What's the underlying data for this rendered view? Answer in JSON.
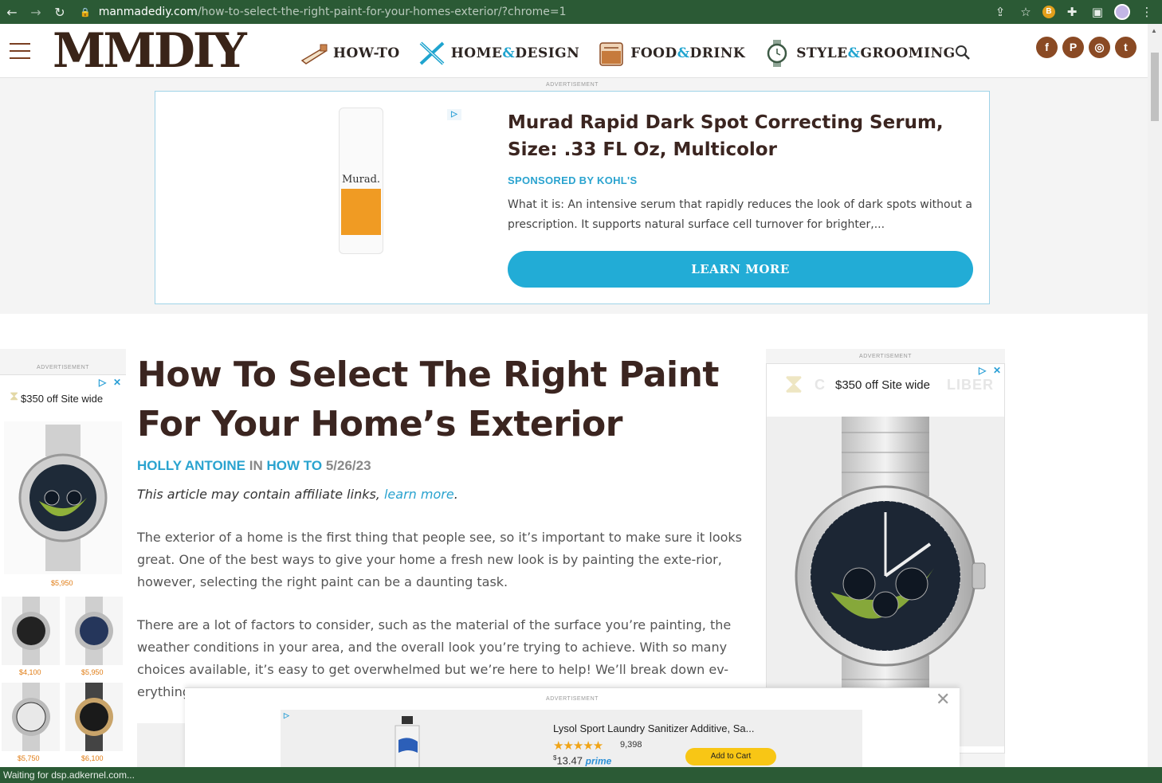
{
  "browser": {
    "url_host": "manmadediy.com",
    "url_path": "/how-to-select-the-right-paint-for-your-homes-exterior/?chrome=1",
    "status_text": "Waiting for dsp.adkernel.com..."
  },
  "site": {
    "logo": "MMDIY",
    "nav": [
      {
        "pre": "HOW-TO",
        "amp": "",
        "post": ""
      },
      {
        "pre": "HOME",
        "amp": "&",
        "post": "DESIGN"
      },
      {
        "pre": "FOOD",
        "amp": "&",
        "post": "DRINK"
      },
      {
        "pre": "STYLE",
        "amp": "&",
        "post": "GROOMING"
      }
    ],
    "social_icons": [
      "facebook-icon",
      "pinterest-icon",
      "instagram-icon",
      "twitter-icon"
    ]
  },
  "top_ad": {
    "label": "ADVERTISEMENT",
    "product_brand": "Murad.",
    "title": "Murad Rapid Dark Spot Correcting Serum, Size: .33 FL Oz, Multicolor",
    "sponsor": "SPONSORED BY KOHL'S",
    "description": "What it is: An intensive serum that rapidly reduces the look of dark spots without a prescription. It supports natural surface cell turnover for brighter,...",
    "cta": "LEARN MORE",
    "accent": "#22acd6"
  },
  "left_ad": {
    "label": "ADVERTISEMENT",
    "headline": "$350 off Site wide",
    "prices": [
      "$5,950",
      "$4,100",
      "$5,950",
      "$5,750",
      "$6,100"
    ]
  },
  "article": {
    "title": "How To Select The Right Paint For Your Home’s Exterior",
    "author": "HOLLY ANTOINE",
    "in_word": "IN",
    "category": "HOW TO",
    "date": "5/26/23",
    "affiliate_text": "This article may contain affiliate links, ",
    "affiliate_link": "learn more",
    "affiliate_end": ".",
    "paragraphs": [
      "The exterior of a home is the first thing that people see, so it’s important to make sure it looks great. One of the best ways to give your home a fresh new look is by painting the exte-rior, however, selecting the right paint can be a daunting task.",
      "There are a lot of factors to consider, such as the material of the surface you’re painting, the weather conditions in your area, and the overall look you’re trying to achieve. With so many choices available, it’s easy to get overwhelmed but we’re here to help! We’ll break down ev-erything"
    ]
  },
  "right_ad": {
    "label": "ADVERTISEMENT",
    "headline": "$350 off Site wide",
    "ghost_left": "C",
    "ghost_right": "LIBER"
  },
  "sticky_ad": {
    "label": "ADVERTISEMENT",
    "product": "Lysol Sport Laundry Sanitizer Additive, Sa...",
    "stars": "★★★★★",
    "reviews": "9,398",
    "price_symbol": "$",
    "price": "13.47",
    "prime": "prime",
    "cta": "Add to Cart"
  }
}
